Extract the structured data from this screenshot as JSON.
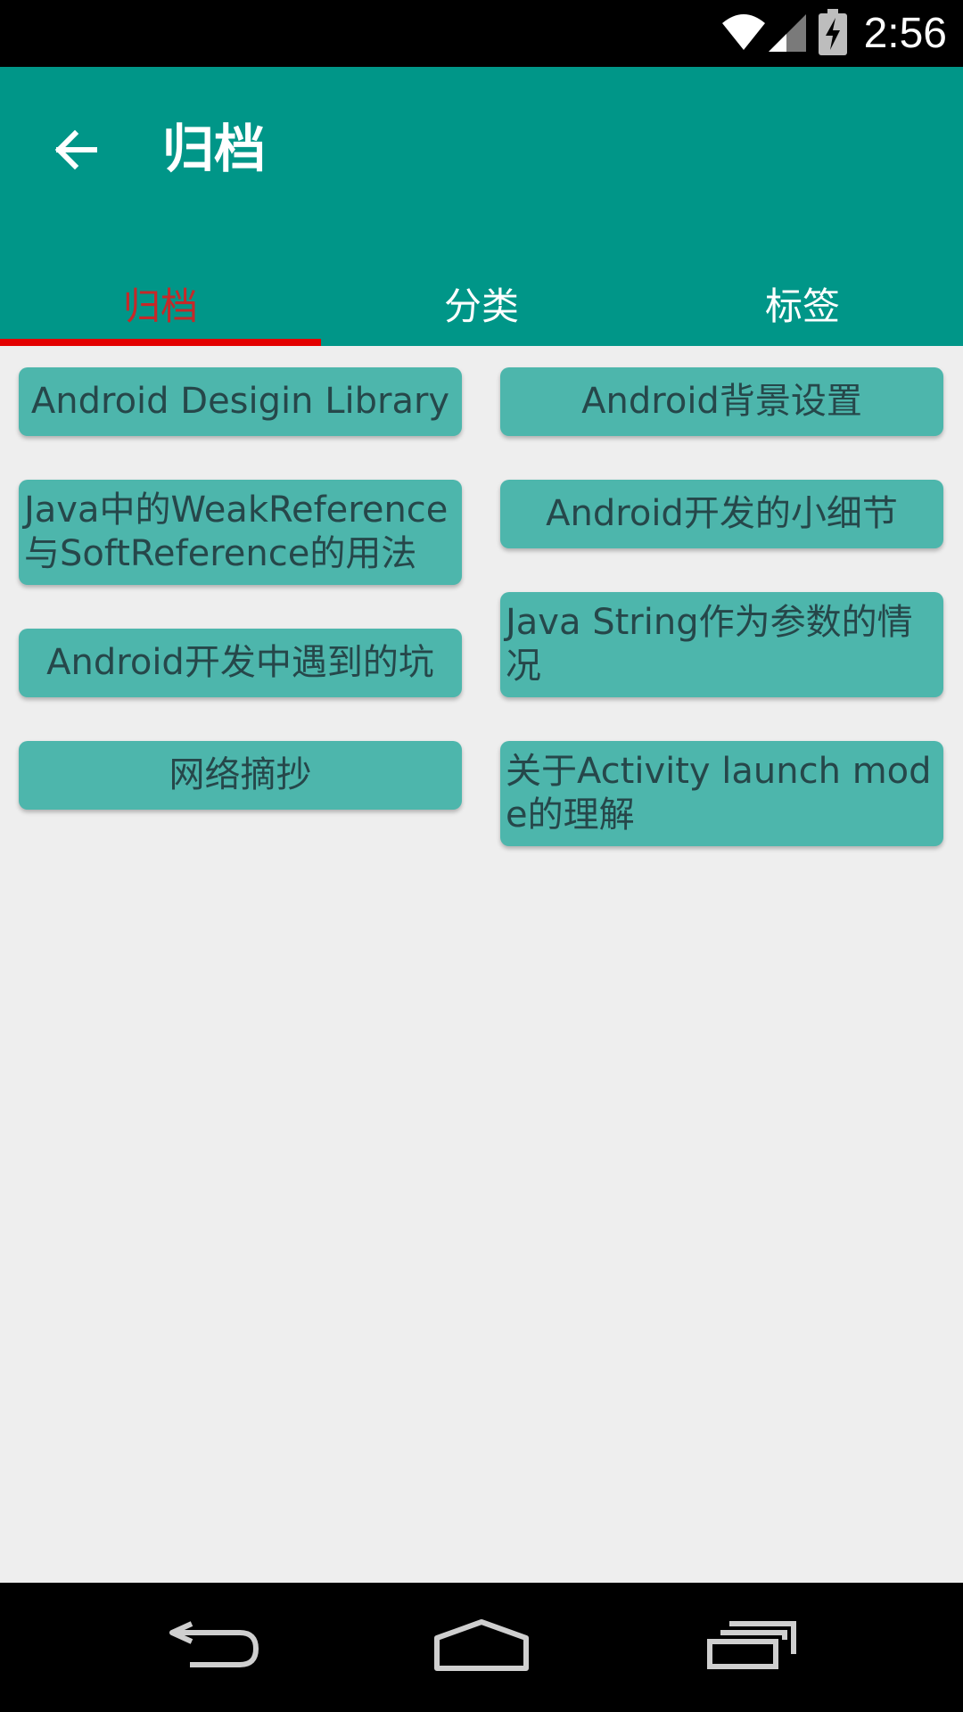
{
  "status_bar": {
    "time": "2:56",
    "icons": [
      "wifi-icon",
      "cell-signal-icon",
      "battery-charging-icon"
    ]
  },
  "app_bar": {
    "back_icon": "arrow-back-icon",
    "title": "归档"
  },
  "tabs": [
    {
      "label": "归档",
      "active": true
    },
    {
      "label": "分类",
      "active": false
    },
    {
      "label": "标签",
      "active": false
    }
  ],
  "colors": {
    "app_bar": "#009688",
    "chip": "#4db6ac",
    "active_tab": "#c62828",
    "indicator": "#e30000",
    "background": "#eeeeee"
  },
  "archive": {
    "left": [
      "Android Desigin Library",
      "Java中的WeakReference与SoftReference的用法",
      "Android开发中遇到的坑",
      "网络摘抄"
    ],
    "right": [
      "Android背景设置",
      "Android开发的小细节",
      "Java String作为参数的情况",
      "关于Activity launch mode的理解"
    ]
  },
  "nav_bar": {
    "icons": [
      "back-nav-icon",
      "home-nav-icon",
      "recents-nav-icon"
    ]
  }
}
